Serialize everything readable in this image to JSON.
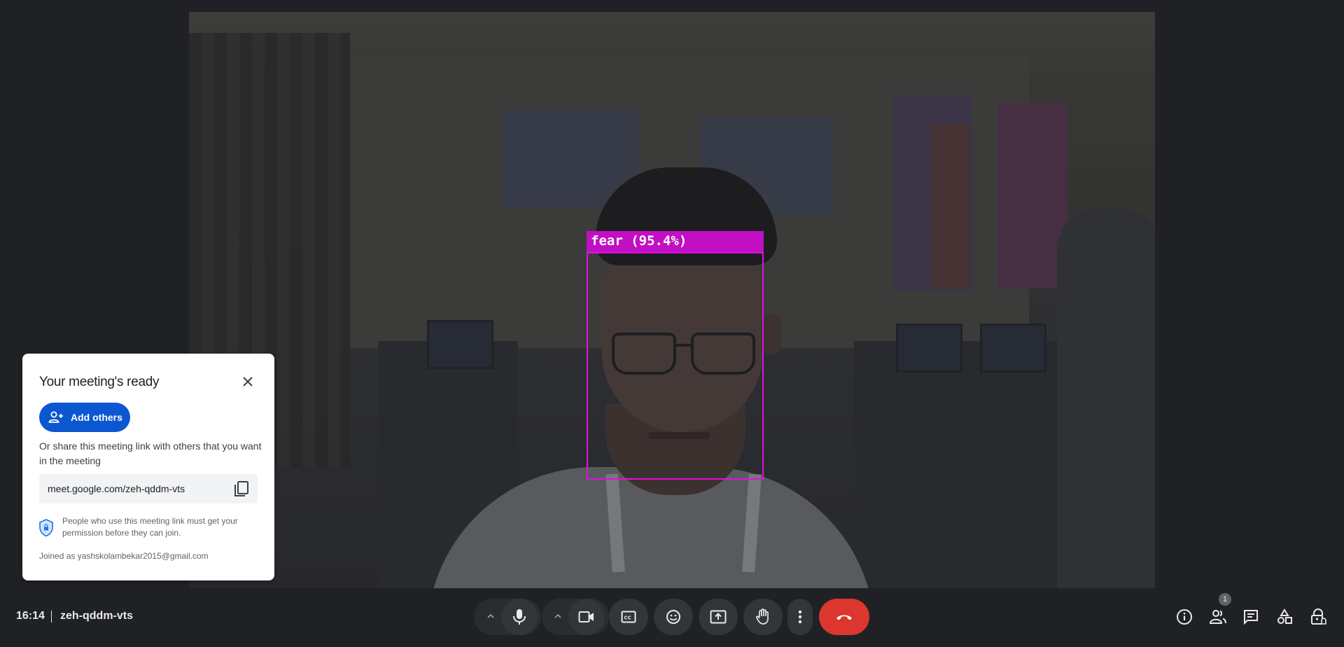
{
  "video": {
    "detection_label": "fear (95.4%)"
  },
  "card": {
    "title": "Your meeting's ready",
    "add_others_label": "Add others",
    "share_text": "Or share this meeting link with others that you want in the meeting",
    "meeting_link": "meet.google.com/zeh-qddm-vts",
    "permission_text": "People who use this meeting link must get your permission before they can join.",
    "joined_as": "Joined as yashskolambekar2015@gmail.com"
  },
  "bottom_bar": {
    "time": "16:14",
    "meeting_code": "zeh-qddm-vts",
    "participants_count": "1",
    "controls": [
      "audio-options",
      "microphone",
      "video-options",
      "camera",
      "captions",
      "reactions",
      "present",
      "raise-hand",
      "more-options",
      "leave-call"
    ],
    "right_controls": [
      "meeting-details",
      "people",
      "chat",
      "activities",
      "host-controls"
    ]
  },
  "colors": {
    "accent_blue": "#0b57d0",
    "end_call_red": "#dc362e",
    "detection_magenta": "#e010e0",
    "background": "#202124"
  }
}
